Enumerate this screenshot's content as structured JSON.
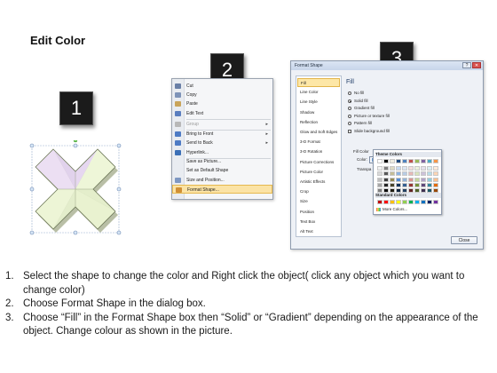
{
  "title": "Edit Color",
  "badges": [
    "1",
    "2",
    "3"
  ],
  "context_menu": {
    "items": [
      {
        "label": "Cut",
        "icon": "scissors-icon",
        "color": "#6a7fa6",
        "disabled": false,
        "arrow": false
      },
      {
        "label": "Copy",
        "icon": "copy-icon",
        "color": "#7e93b8",
        "disabled": false,
        "arrow": false
      },
      {
        "label": "Paste",
        "icon": "paste-icon",
        "color": "#c9a45a",
        "disabled": false,
        "arrow": false
      },
      {
        "label": "Edit Text",
        "icon": "edit-text-icon",
        "color": "#5a7ebf",
        "disabled": false,
        "arrow": false
      },
      {
        "label": "Group",
        "icon": "group-icon",
        "color": "#b8b8b8",
        "disabled": true,
        "arrow": true
      },
      {
        "label": "Bring to Front",
        "icon": "bring-front-icon",
        "color": "#4e7bc4",
        "disabled": false,
        "arrow": true
      },
      {
        "label": "Send to Back",
        "icon": "send-back-icon",
        "color": "#4e7bc4",
        "disabled": false,
        "arrow": true
      },
      {
        "label": "Hyperlink...",
        "icon": "hyperlink-icon",
        "color": "#3b6fb6",
        "disabled": false,
        "arrow": false
      },
      {
        "label": "Save as Picture...",
        "icon": "",
        "color": "",
        "disabled": false,
        "arrow": false
      },
      {
        "label": "Set as Default Shape",
        "icon": "",
        "color": "",
        "disabled": false,
        "arrow": false
      },
      {
        "label": "Size and Position...",
        "icon": "size-position-icon",
        "color": "#7f98c2",
        "disabled": false,
        "arrow": false
      },
      {
        "label": "Format Shape...",
        "icon": "format-shape-icon",
        "color": "#d08f36",
        "disabled": false,
        "arrow": false,
        "highlight": true
      }
    ]
  },
  "dialog": {
    "title": "Format Shape",
    "nav": [
      "Fill",
      "Line Color",
      "Line Style",
      "Shadow",
      "Reflection",
      "Glow and Soft Edges",
      "3-D Format",
      "3-D Rotation",
      "Picture Corrections",
      "Picture Color",
      "Artistic Effects",
      "Crop",
      "Size",
      "Position",
      "Text Box",
      "Alt Text"
    ],
    "selected_nav": "Fill",
    "pane_heading": "Fill",
    "options": [
      {
        "label": "No fill",
        "type": "radio",
        "checked": false
      },
      {
        "label": "Solid fill",
        "type": "radio",
        "checked": true
      },
      {
        "label": "Gradient fill",
        "type": "radio",
        "checked": false
      },
      {
        "label": "Picture or texture fill",
        "type": "radio",
        "checked": false
      },
      {
        "label": "Pattern fill",
        "type": "radio",
        "checked": false
      },
      {
        "label": "Slide background fill",
        "type": "checkbox",
        "checked": false
      }
    ],
    "fill_color_label": "Fill Color",
    "color_label": "Color:",
    "transparency_label": "Transpa",
    "close_label": "Close"
  },
  "palette": {
    "theme_label": "Theme Colors",
    "standard_label": "Standard Colors",
    "more_label": "More Colors...",
    "theme_top": [
      "#ffffff",
      "#000000",
      "#eeece1",
      "#1f497d",
      "#4f81bd",
      "#c0504d",
      "#9bbb59",
      "#8064a2",
      "#4bacc6",
      "#f79646"
    ],
    "theme_shades": [
      [
        "#f2f2f2",
        "#7f7f7f",
        "#ddd9c3",
        "#c6d9f0",
        "#dbe5f1",
        "#f2dcdb",
        "#ebf1dd",
        "#e5e0ec",
        "#dbeef3",
        "#fdeada"
      ],
      [
        "#d8d8d8",
        "#595959",
        "#c4bd97",
        "#8db3e2",
        "#b8cce4",
        "#e5b9b7",
        "#d7e3bc",
        "#ccc1d9",
        "#b7dde8",
        "#fbd5b5"
      ],
      [
        "#bfbfbf",
        "#3f3f3f",
        "#938953",
        "#548dd4",
        "#95b3d7",
        "#d99694",
        "#c3d69b",
        "#b2a2c7",
        "#92cddc",
        "#fac08f"
      ],
      [
        "#a5a5a5",
        "#262626",
        "#494429",
        "#17365d",
        "#366092",
        "#953734",
        "#76923c",
        "#5f497a",
        "#31859b",
        "#e36c09"
      ],
      [
        "#7f7f7f",
        "#0c0c0c",
        "#1d1b10",
        "#0f243e",
        "#244061",
        "#632423",
        "#4f6128",
        "#3f3151",
        "#205867",
        "#974806"
      ]
    ],
    "standard": [
      "#c00000",
      "#ff0000",
      "#ffc000",
      "#ffff00",
      "#92d050",
      "#00b050",
      "#00b0f0",
      "#0070c0",
      "#002060",
      "#7030a0"
    ]
  },
  "steps": [
    {
      "num": "1.",
      "text": "Select the shape to change the color and Right click the object( click any object which you want to change color)"
    },
    {
      "num": "2.",
      "text": "Choose Format Shape in the dialog box."
    },
    {
      "num": "3.",
      "text": "Choose “Fill” in the Format Shape box then “Solid” or “Gradient” depending on the appearance of the object. Change colour as shown in the picture."
    }
  ]
}
